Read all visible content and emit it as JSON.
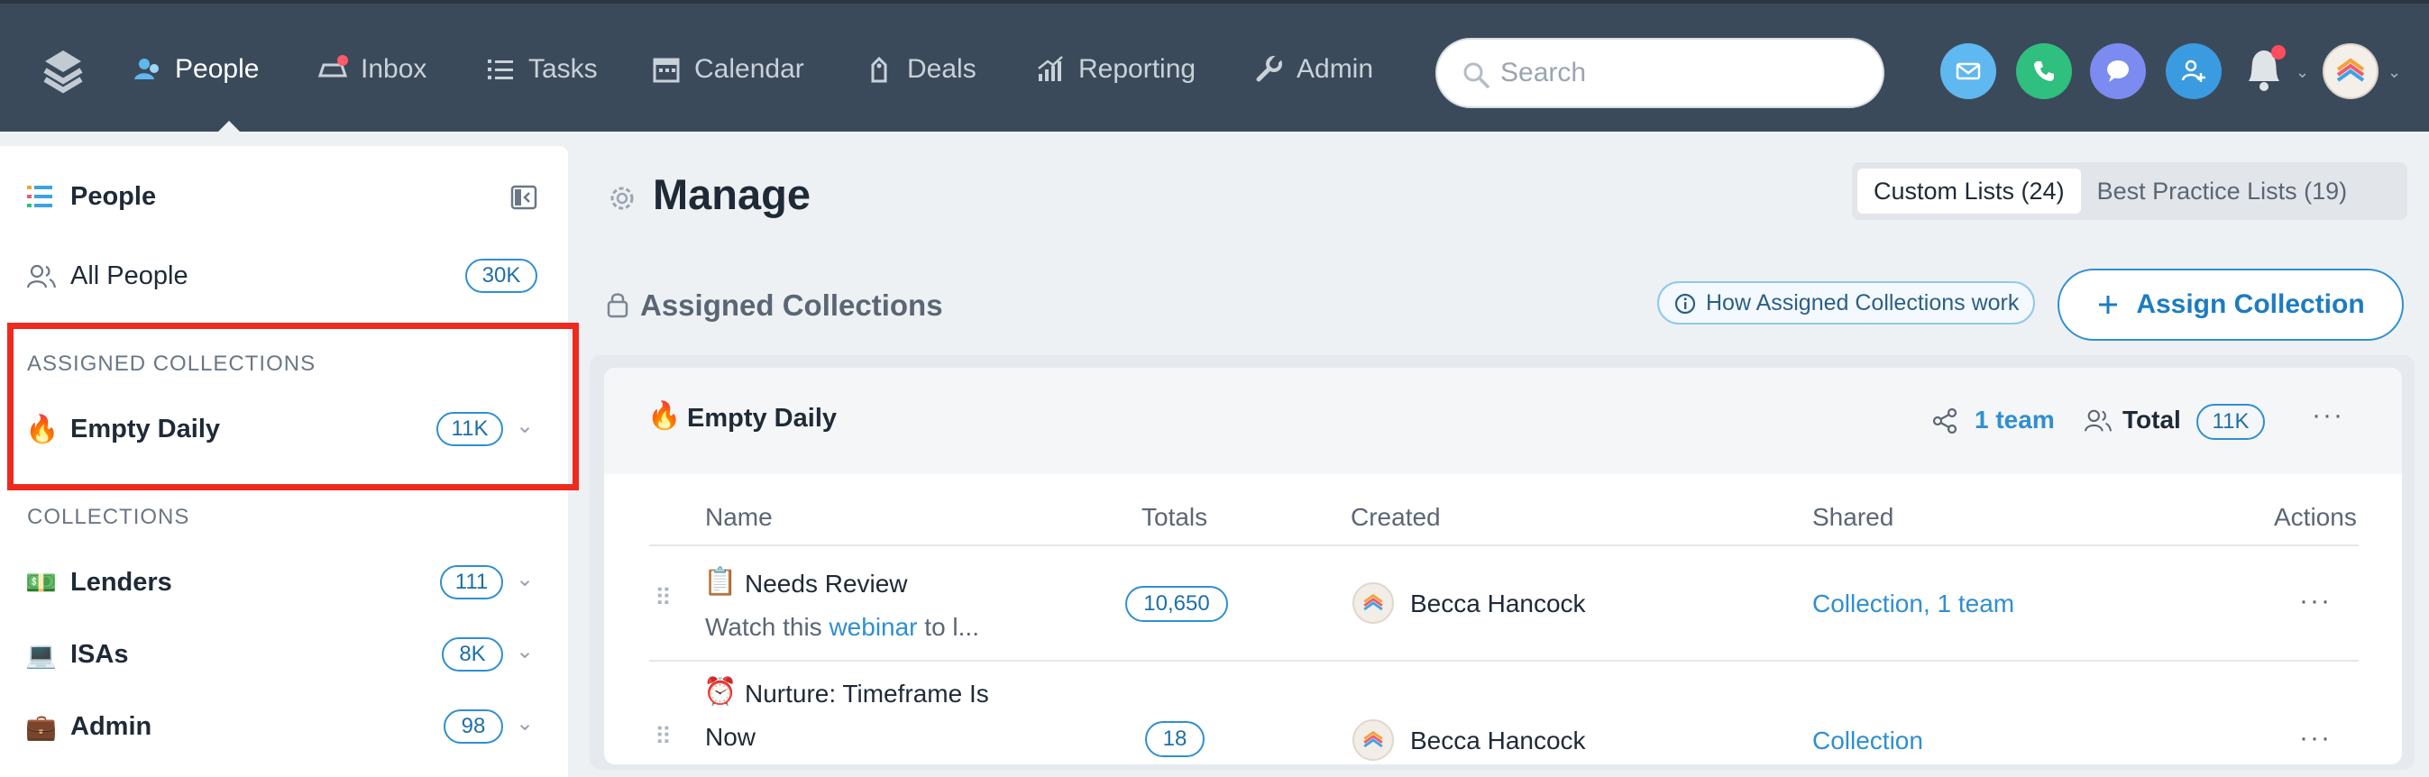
{
  "nav": {
    "items": [
      {
        "label": "People",
        "icon": "people-icon",
        "active": true
      },
      {
        "label": "Inbox",
        "icon": "inbox-icon"
      },
      {
        "label": "Tasks",
        "icon": "tasks-icon"
      },
      {
        "label": "Calendar",
        "icon": "calendar-icon"
      },
      {
        "label": "Deals",
        "icon": "deals-icon"
      },
      {
        "label": "Reporting",
        "icon": "reporting-icon"
      },
      {
        "label": "Admin",
        "icon": "admin-icon"
      }
    ],
    "search_placeholder": "Search",
    "quick_actions": [
      "email-icon",
      "phone-icon",
      "chat-icon",
      "add-person-icon"
    ],
    "colors": {
      "bar": "#3b4a5a",
      "email": "#5fb8ef",
      "phone": "#2fbf7f",
      "chat": "#7b8bf0",
      "add_person": "#3a9be0"
    }
  },
  "sidebar": {
    "title": "People",
    "all_people": {
      "label": "All People",
      "count": "30K"
    },
    "assigned_section": "ASSIGNED COLLECTIONS",
    "assigned_items": [
      {
        "emoji": "🔥",
        "label": "Empty Daily",
        "count": "11K"
      }
    ],
    "collections_section": "COLLECTIONS",
    "collections": [
      {
        "emoji": "💵",
        "label": "Lenders",
        "count": "111"
      },
      {
        "emoji": "💻",
        "label": "ISAs",
        "count": "8K"
      },
      {
        "emoji": "💼",
        "label": "Admin",
        "count": "98"
      }
    ]
  },
  "main": {
    "title": "Manage",
    "tabs": [
      {
        "label": "Custom Lists (24)",
        "active": true
      },
      {
        "label": "Best Practice Lists (19)"
      }
    ],
    "assigned_title": "Assigned Collections",
    "howto_label": "How Assigned Collections work",
    "assign_button": "Assign Collection",
    "collection": {
      "emoji": "🔥",
      "name": "Empty Daily",
      "teams": "1 team",
      "total_label": "Total",
      "total_count": "11K"
    },
    "columns": [
      "Name",
      "Totals",
      "Created",
      "Shared",
      "Actions"
    ],
    "rows": [
      {
        "emoji": "📋",
        "name": "Needs Review",
        "desc_prefix": "Watch this ",
        "desc_link": "webinar",
        "desc_suffix": " to l...",
        "total": "10,650",
        "created_by": "Becca Hancock",
        "shared": "Collection, 1 team"
      },
      {
        "emoji": "⏰",
        "name": "Nurture: Timeframe Is",
        "name_line2": "Now",
        "total": "18",
        "created_by": "Becca Hancock",
        "shared": "Collection"
      }
    ]
  }
}
